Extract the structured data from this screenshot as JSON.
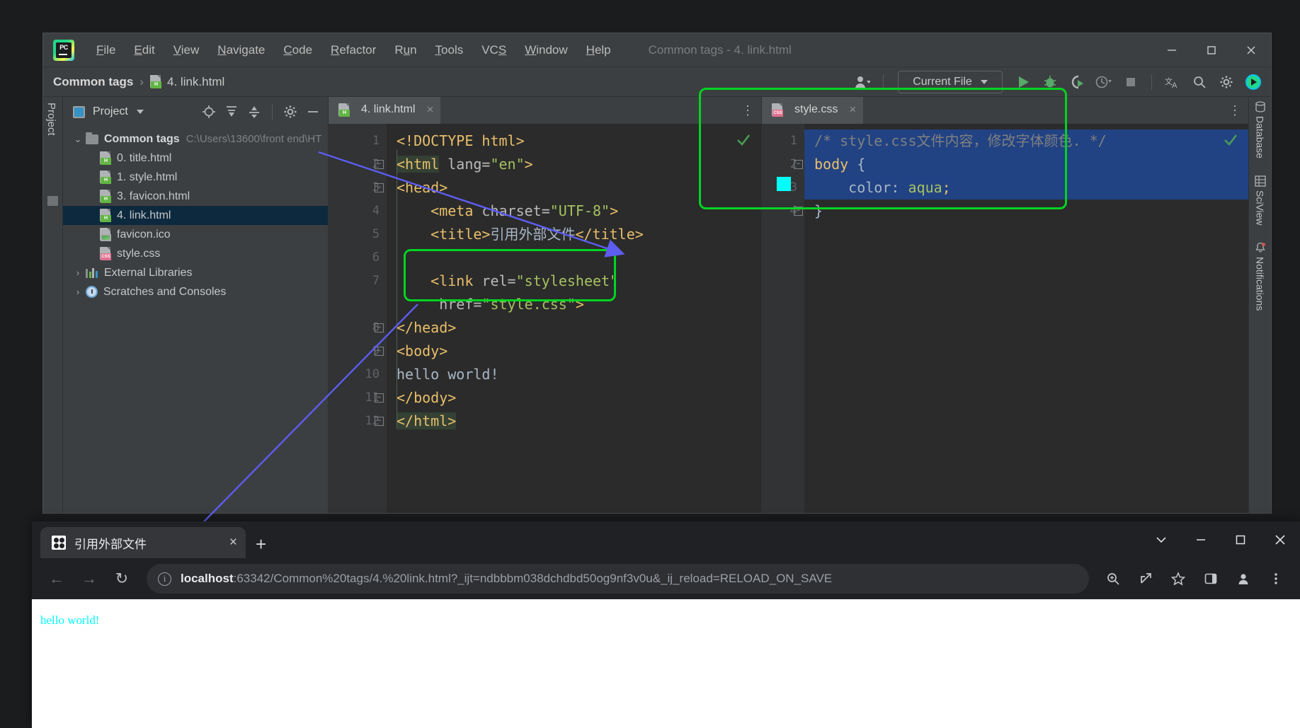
{
  "ide": {
    "window_title": "Common tags - 4. link.html",
    "menu": [
      {
        "label": "File",
        "mnemonic": "F"
      },
      {
        "label": "Edit",
        "mnemonic": "E"
      },
      {
        "label": "View",
        "mnemonic": "V"
      },
      {
        "label": "Navigate",
        "mnemonic": "N"
      },
      {
        "label": "Code",
        "mnemonic": "C"
      },
      {
        "label": "Refactor",
        "mnemonic": "R"
      },
      {
        "label": "Run",
        "mnemonic": "u"
      },
      {
        "label": "Tools",
        "mnemonic": "T"
      },
      {
        "label": "VCS",
        "mnemonic": "S"
      },
      {
        "label": "Window",
        "mnemonic": "W"
      },
      {
        "label": "Help",
        "mnemonic": "H"
      }
    ],
    "breadcrumb": {
      "project": "Common tags",
      "separator": "›",
      "file": "4. link.html"
    },
    "run_config": "Current File",
    "toolbar_icons": [
      "user-avatar-icon",
      "run-icon",
      "debug-icon",
      "run-with-coverage-icon",
      "profiler-icon",
      "stop-icon",
      "translate-icon",
      "search-icon",
      "settings-gear-icon",
      "pycharm-icon"
    ],
    "window_controls": [
      "minimize-icon",
      "maximize-icon",
      "close-icon"
    ]
  },
  "project_panel": {
    "title": "Project",
    "tool_buttons": [
      "locate-icon",
      "expand-all-icon",
      "collapse-all-icon",
      "settings-gear-icon",
      "hide-icon"
    ],
    "tree": [
      {
        "label": "Common tags",
        "path": "C:\\Users\\13600\\front end\\HT",
        "type": "folder",
        "expanded": true,
        "indent": 0,
        "selected": false
      },
      {
        "label": "0. title.html",
        "type": "html",
        "indent": 1,
        "selected": false
      },
      {
        "label": "1. style.html",
        "type": "html",
        "indent": 1,
        "selected": false
      },
      {
        "label": "3. favicon.html",
        "type": "html",
        "indent": 1,
        "selected": false
      },
      {
        "label": "4. link.html",
        "type": "html",
        "indent": 1,
        "selected": true
      },
      {
        "label": "favicon.ico",
        "type": "image",
        "indent": 1,
        "selected": false
      },
      {
        "label": "style.css",
        "type": "css",
        "indent": 1,
        "selected": false
      },
      {
        "label": "External Libraries",
        "type": "library",
        "expanded": false,
        "indent": 0,
        "selected": false
      },
      {
        "label": "Scratches and Consoles",
        "type": "scratches",
        "expanded": false,
        "indent": 0,
        "selected": false
      }
    ]
  },
  "editor_html": {
    "tab_label": "4. link.html",
    "tab_icon": "html-file-icon",
    "inspection_status": "ok-check-icon",
    "lines": [
      {
        "n": "1",
        "fold": false,
        "html": "<span class='k-tag'>&lt;!DOCTYPE html&gt;</span>"
      },
      {
        "n": "2",
        "fold": true,
        "html": "<span class='k-tag hl-el'>&lt;html</span><span class='k-attr'> lang=</span><span class='k-val'>\"en\"</span><span class='k-tag'>&gt;</span>"
      },
      {
        "n": "3",
        "fold": true,
        "html": "<span class='k-tag'>&lt;head&gt;</span>"
      },
      {
        "n": "4",
        "fold": false,
        "html": "    <span class='k-tag'>&lt;meta</span><span class='k-attr'> charset=</span><span class='k-val'>\"UTF-8\"</span><span class='k-tag'>&gt;</span>"
      },
      {
        "n": "5",
        "fold": false,
        "html": "    <span class='k-tag'>&lt;title&gt;</span><span class='k-txt'>引用外部文件</span><span class='k-tag'>&lt;/title&gt;</span>"
      },
      {
        "n": "6",
        "fold": false,
        "html": ""
      },
      {
        "n": "7",
        "fold": false,
        "html": "    <span class='k-tag'>&lt;link</span><span class='k-attr'> rel=</span><span class='k-val'>\"stylesheet\"</span>"
      },
      {
        "n": "",
        "fold": false,
        "html": "     <span class='k-attr'>href=</span><span class='k-val'>\"style.css\"</span><span class='k-tag'>&gt;</span>"
      },
      {
        "n": "8",
        "fold": true,
        "html": "<span class='k-tag'>&lt;/head&gt;</span>"
      },
      {
        "n": "9",
        "fold": true,
        "html": "<span class='k-tag'>&lt;body&gt;</span>"
      },
      {
        "n": "10",
        "fold": false,
        "html": "<span class='k-txt'>hello world!</span>"
      },
      {
        "n": "11",
        "fold": true,
        "html": "<span class='k-tag'>&lt;/body&gt;</span>"
      },
      {
        "n": "12",
        "fold": true,
        "html": "<span class='k-tag hl-el'>&lt;/html&gt;</span>"
      }
    ],
    "source_text": "<!DOCTYPE html>\n<html lang=\"en\">\n<head>\n    <meta charset=\"UTF-8\">\n    <title>引用外部文件</title>\n\n    <link rel=\"stylesheet\" href=\"style.css\">\n</head>\n<body>\nhello world!\n</body>\n</html>",
    "highlight_note": "link rel=stylesheet href=style.css"
  },
  "editor_css": {
    "tab_label": "style.css",
    "tab_icon": "css-file-icon",
    "inspection_status": "ok-check-icon",
    "color_swatch": "#00ffff",
    "lines": [
      {
        "n": "1",
        "fold": false,
        "html": "<span class='k-cmt'>/* style.css文件内容，修改字体颜色. */</span>"
      },
      {
        "n": "2",
        "fold": true,
        "html": "<span class='k-tag'>body</span><span class='k-txt'> {</span>"
      },
      {
        "n": "3",
        "fold": false,
        "html": "    <span class='k-txt'>color</span><span class='k-txt'>: </span><span class='k-val'>aqua</span><span class='k-tag'>;</span>"
      },
      {
        "n": "4",
        "fold": true,
        "html": "<span class='k-txt'>}</span>"
      }
    ],
    "source_text": "/* style.css文件内容，修改字体颜色. */\nbody {\n    color: aqua;\n}"
  },
  "right_sidebar": [
    {
      "label": "Database",
      "icon": "database-icon"
    },
    {
      "label": "SciView",
      "icon": "sciview-icon"
    },
    {
      "label": "Notifications",
      "icon": "notifications-bell-icon"
    }
  ],
  "browser": {
    "tab_title": "引用外部文件",
    "tab_close": "×",
    "new_tab": "+",
    "url_host": "localhost",
    "url_rest": ":63342/Common%20tags/4.%20link.html?_ijt=ndbbbm038dchdbd50og9nf3v0u&_ij_reload=RELOAD_ON_SAVE",
    "nav_back": "←",
    "nav_forward": "→",
    "nav_reload": "↻",
    "page_content": "hello world!",
    "page_text_color": "#00ffff",
    "toolbar_icons": [
      "zoom-icon",
      "share-icon",
      "bookmark-star-icon",
      "side-panel-icon",
      "profile-icon",
      "more-menu-icon"
    ],
    "window_controls": [
      "chevron-down-icon",
      "minimize-icon",
      "maximize-icon",
      "close-icon"
    ]
  },
  "annotations": {
    "highlight_color": "#00d421",
    "arrow_color": "#5d5df0",
    "boxes": [
      "link-tag-highlight",
      "style-css-editor-highlight"
    ],
    "arrows": [
      "link-to-css-arrow",
      "link-to-rendered-text-arrow"
    ]
  }
}
